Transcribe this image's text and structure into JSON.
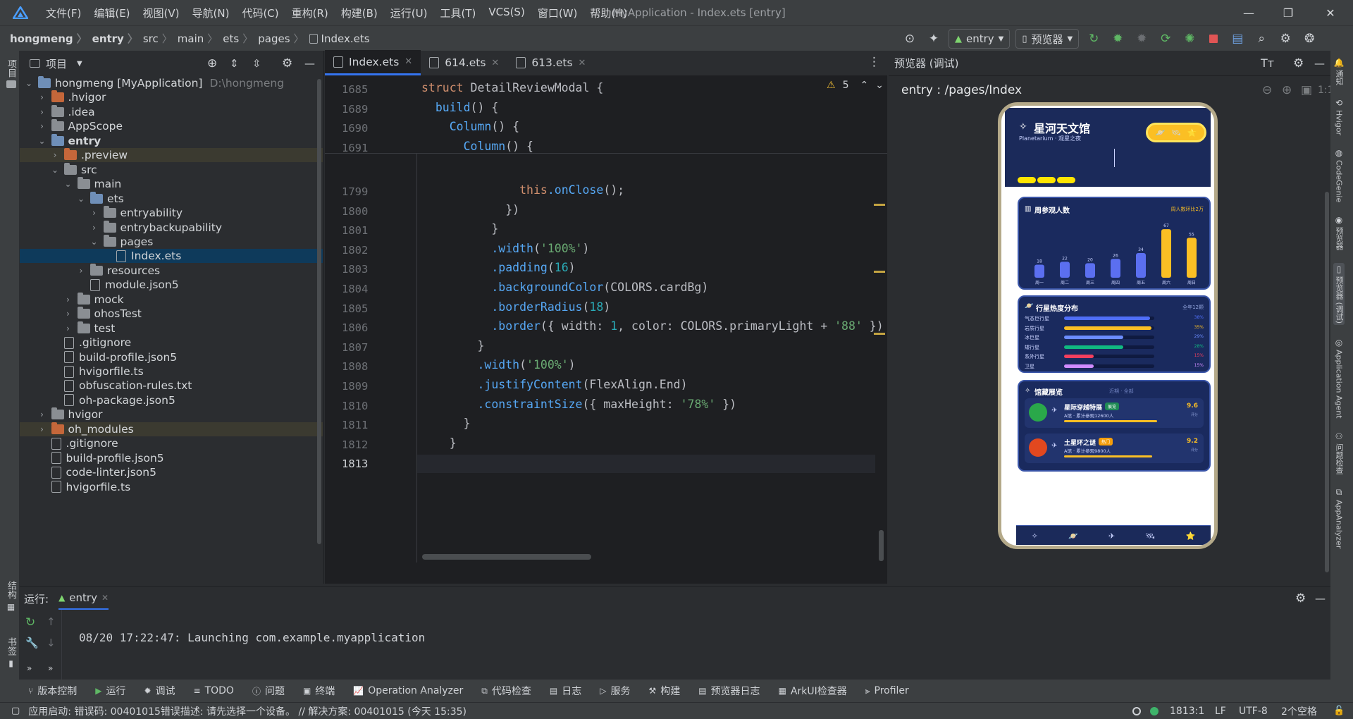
{
  "menu": {
    "items": [
      "文件(F)",
      "编辑(E)",
      "视图(V)",
      "导航(N)",
      "代码(C)",
      "重构(R)",
      "构建(B)",
      "运行(U)",
      "工具(T)",
      "VCS(S)",
      "窗口(W)",
      "帮助(H)"
    ],
    "window_title": "MyApplication - Index.ets [entry]"
  },
  "breadcrumb": [
    "hongmeng",
    "entry",
    "src",
    "main",
    "ets",
    "pages",
    "Index.ets"
  ],
  "toolbar": {
    "run_config": "entry",
    "device": "预览器"
  },
  "project_panel": {
    "title": "项目",
    "tree": [
      {
        "label": "hongmeng [MyApplication]",
        "extra": "D:\\hongmeng",
        "depth": 0,
        "arrow": "down",
        "icon": "folder-blue"
      },
      {
        "label": ".hvigor",
        "depth": 1,
        "arrow": "right",
        "icon": "folder-orange"
      },
      {
        "label": ".idea",
        "depth": 1,
        "arrow": "right",
        "icon": "folder-gray"
      },
      {
        "label": "AppScope",
        "depth": 1,
        "arrow": "right",
        "icon": "folder-gray"
      },
      {
        "label": "entry",
        "depth": 1,
        "arrow": "down",
        "icon": "folder-blue",
        "bold": true
      },
      {
        "label": ".preview",
        "depth": 2,
        "arrow": "right",
        "icon": "folder-orange",
        "tint": true
      },
      {
        "label": "src",
        "depth": 2,
        "arrow": "down",
        "icon": "folder-gray"
      },
      {
        "label": "main",
        "depth": 3,
        "arrow": "down",
        "icon": "folder-gray"
      },
      {
        "label": "ets",
        "depth": 4,
        "arrow": "down",
        "icon": "folder-blue"
      },
      {
        "label": "entryability",
        "depth": 5,
        "arrow": "right",
        "icon": "folder-gray"
      },
      {
        "label": "entrybackupability",
        "depth": 5,
        "arrow": "right",
        "icon": "folder-gray"
      },
      {
        "label": "pages",
        "depth": 5,
        "arrow": "down",
        "icon": "folder-gray"
      },
      {
        "label": "Index.ets",
        "depth": 6,
        "arrow": "",
        "icon": "file",
        "selected": true
      },
      {
        "label": "resources",
        "depth": 4,
        "arrow": "right",
        "icon": "folder-gray"
      },
      {
        "label": "module.json5",
        "depth": 4,
        "arrow": "",
        "icon": "file"
      },
      {
        "label": "mock",
        "depth": 3,
        "arrow": "right",
        "icon": "folder-gray"
      },
      {
        "label": "ohosTest",
        "depth": 3,
        "arrow": "right",
        "icon": "folder-gray"
      },
      {
        "label": "test",
        "depth": 3,
        "arrow": "right",
        "icon": "folder-gray"
      },
      {
        "label": ".gitignore",
        "depth": 2,
        "arrow": "",
        "icon": "file"
      },
      {
        "label": "build-profile.json5",
        "depth": 2,
        "arrow": "",
        "icon": "file"
      },
      {
        "label": "hvigorfile.ts",
        "depth": 2,
        "arrow": "",
        "icon": "file"
      },
      {
        "label": "obfuscation-rules.txt",
        "depth": 2,
        "arrow": "",
        "icon": "file"
      },
      {
        "label": "oh-package.json5",
        "depth": 2,
        "arrow": "",
        "icon": "file"
      },
      {
        "label": "hvigor",
        "depth": 1,
        "arrow": "right",
        "icon": "folder-gray"
      },
      {
        "label": "oh_modules",
        "depth": 1,
        "arrow": "right",
        "icon": "folder-orange",
        "tint": true
      },
      {
        "label": ".gitignore",
        "depth": 1,
        "arrow": "",
        "icon": "file"
      },
      {
        "label": "build-profile.json5",
        "depth": 1,
        "arrow": "",
        "icon": "file"
      },
      {
        "label": "code-linter.json5",
        "depth": 1,
        "arrow": "",
        "icon": "file"
      },
      {
        "label": "hvigorfile.ts",
        "depth": 1,
        "arrow": "",
        "icon": "file"
      }
    ]
  },
  "editor": {
    "tabs": [
      {
        "label": "Index.ets",
        "active": true
      },
      {
        "label": "614.ets",
        "active": false
      },
      {
        "label": "613.ets",
        "active": false
      }
    ],
    "warnings": "5",
    "sticky_lines": [
      {
        "n": "1685",
        "code": "struct DetailReviewModal {"
      },
      {
        "n": "1689",
        "code": "  build() {"
      },
      {
        "n": "1690",
        "code": "    Column() {"
      },
      {
        "n": "1691",
        "code": "      Column() {"
      }
    ],
    "lines": [
      {
        "n": "1799",
        "code": "              this.onClose();"
      },
      {
        "n": "1800",
        "code": "            })"
      },
      {
        "n": "1801",
        "code": "          }"
      },
      {
        "n": "1802",
        "code": "          .width('100%')"
      },
      {
        "n": "1803",
        "code": "          .padding(16)"
      },
      {
        "n": "1804",
        "code": "          .backgroundColor(COLORS.cardBg)"
      },
      {
        "n": "1805",
        "code": "          .borderRadius(18)"
      },
      {
        "n": "1806",
        "code": "          .border({ width: 1, color: COLORS.primaryLight + '88' })"
      },
      {
        "n": "1807",
        "code": "        }"
      },
      {
        "n": "1808",
        "code": "        .width('100%')"
      },
      {
        "n": "1809",
        "code": "        .justifyContent(FlexAlign.End)"
      },
      {
        "n": "1810",
        "code": "        .constraintSize({ maxHeight: '78%' })"
      },
      {
        "n": "1811",
        "code": "      }"
      },
      {
        "n": "1812",
        "code": "    }"
      },
      {
        "n": "1813",
        "code": ""
      }
    ]
  },
  "preview": {
    "panel_title": "预览器 (调试)",
    "route": "entry : /pages/Index",
    "app": {
      "title": "星河天文馆",
      "subtitle": "Planetarium · 观星之夜",
      "visitors_title": "周参观人数",
      "visitors_note": "周人数环比2万",
      "chart_data": {
        "type": "bar",
        "categories": [
          "周一",
          "周二",
          "周三",
          "周四",
          "周五",
          "周六",
          "周日"
        ],
        "values": [
          18,
          22,
          20,
          26,
          34,
          67,
          55
        ]
      },
      "planets_title": "行星热度分布",
      "planets_note": "全年12颗",
      "planets": [
        {
          "name": "气态巨行星",
          "value": 0.95,
          "pct": "38%",
          "color": "#4f6ef7"
        },
        {
          "name": "岩质行星",
          "value": 0.97,
          "pct": "35%",
          "color": "#fbbf24"
        },
        {
          "name": "冰巨星",
          "value": 0.66,
          "pct": "29%",
          "color": "#6b8cff"
        },
        {
          "name": "矮行星",
          "value": 0.66,
          "pct": "28%",
          "color": "#10b981"
        },
        {
          "name": "系外行星",
          "value": 0.33,
          "pct": "15%",
          "color": "#f43f5e"
        },
        {
          "name": "卫星",
          "value": 0.33,
          "pct": "15%",
          "color": "#d08bff"
        }
      ],
      "exhibit_title": "馆藏展览",
      "exhibit_note": "近期 · 全部",
      "exhibits": [
        {
          "name": "星际穿越特展",
          "badge": "展览",
          "desc": "A馆 · 累计参观12600人",
          "score": "9.6",
          "score_label": "评分",
          "color": "#2aa84a",
          "progress": 0.88,
          "badge_color": "#1f8a55"
        },
        {
          "name": "土星环之谜",
          "badge": "热门",
          "desc": "A馆 · 累计参观9800人",
          "score": "9.2",
          "score_label": "评分",
          "color": "#e2481f",
          "progress": 0.83,
          "badge_color": "#f59e0b"
        }
      ]
    }
  },
  "run_panel": {
    "label": "运行:",
    "tab": "entry",
    "log": "08/20 17:22:47: Launching com.example.myapplication"
  },
  "tools": [
    "版本控制",
    "运行",
    "调试",
    "TODO",
    "问题",
    "终端",
    "Operation Analyzer",
    "代码检查",
    "日志",
    "服务",
    "构建",
    "预览器日志",
    "ArkUI检查器",
    "Profiler"
  ],
  "status": {
    "message": "应用启动: 错误码: 00401015错误描述: 请先选择一个设备。 // 解决方案: 00401015 (今天 15:35)",
    "position": "1813:1",
    "line_sep": "LF",
    "encoding": "UTF-8",
    "indent": "2个空格"
  },
  "right_strip": [
    "通知",
    "Hvigor",
    "CodeGenie",
    "预览器",
    "预览器 (调试)",
    "Application Agent",
    "问题检查",
    "AppAnalyzer"
  ],
  "left_strip": [
    "项目",
    "结构",
    "书签"
  ],
  "colors": {
    "accent": "#3574f0",
    "selected_row": "#0e3a5b",
    "app_bg": "#1b2a5a",
    "gold": "#fbbf24"
  }
}
